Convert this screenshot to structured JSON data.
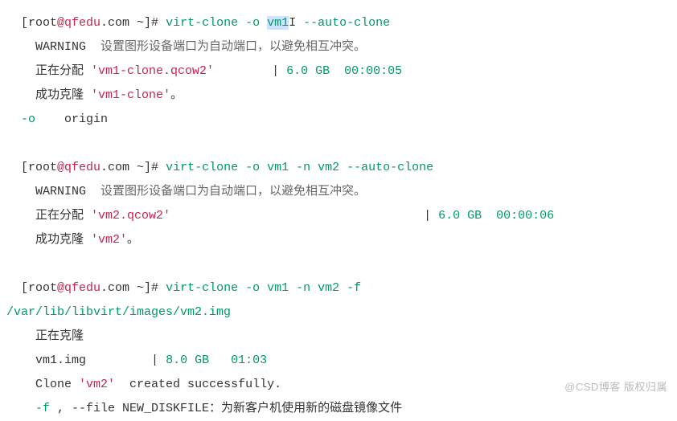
{
  "block1": {
    "prompt_open": "[root",
    "prompt_at": "@qfedu",
    "prompt_dot": ".com ~]# ",
    "cmd_head": "virt-clone -o ",
    "cmd_arg_hl": "vm1",
    "cmd_cursor": "",
    "cmd_rest": " --auto-clone",
    "warn_label": "WARNING  ",
    "warn_text": "设置图形设备端口为自动端口，以避免相互冲突。",
    "alloc_prefix": "正在分配 ",
    "alloc_name": "'vm1-clone.qcow2'",
    "alloc_pad": "        ",
    "alloc_bar": "| ",
    "alloc_size": "6.0 GB",
    "alloc_sep": "  ",
    "alloc_time": "00:00:05",
    "ok_prefix": "成功克隆 ",
    "ok_name": "'vm1-clone'",
    "ok_suffix": "。",
    "opt_o": "-o",
    "opt_o_desc": "    origin"
  },
  "block2": {
    "prompt_open": "[root",
    "prompt_at": "@qfedu",
    "prompt_dot": ".com ~]# ",
    "cmd": "virt-clone -o vm1 -n vm2 --auto-clone",
    "warn_label": "WARNING  ",
    "warn_text": "设置图形设备端口为自动端口，以避免相互冲突。",
    "alloc_prefix": "正在分配 ",
    "alloc_name": "'vm2.qcow2'",
    "alloc_pad": "                                   ",
    "alloc_bar": "| ",
    "alloc_size": "6.0 GB",
    "alloc_sep": "  ",
    "alloc_time": "00:00:06",
    "ok_prefix": "成功克隆 ",
    "ok_name": "'vm2'",
    "ok_suffix": "。"
  },
  "block3": {
    "prompt_open": "[root",
    "prompt_at": "@qfedu",
    "prompt_dot": ".com ~]# ",
    "cmd": "virt-clone -o vm1 -n vm2 -f ",
    "path": "/var/lib/libvirt/images/vm2.img",
    "cloning": "正在克隆",
    "img_name": "vm1.img",
    "img_pad": "         ",
    "img_bar": "| ",
    "img_size": "8.0 GB",
    "img_sep": "   ",
    "img_time": "01:03",
    "created_pre": "Clone ",
    "created_name": "'vm2'",
    "created_post": "  created successfully.",
    "opt_f": "-f ",
    "opt_f_rest": ", --file NEW_DISKFILE：为新客户机使用新的磁盘镜像文件"
  },
  "watermark": "@CSD博客 版权归属"
}
